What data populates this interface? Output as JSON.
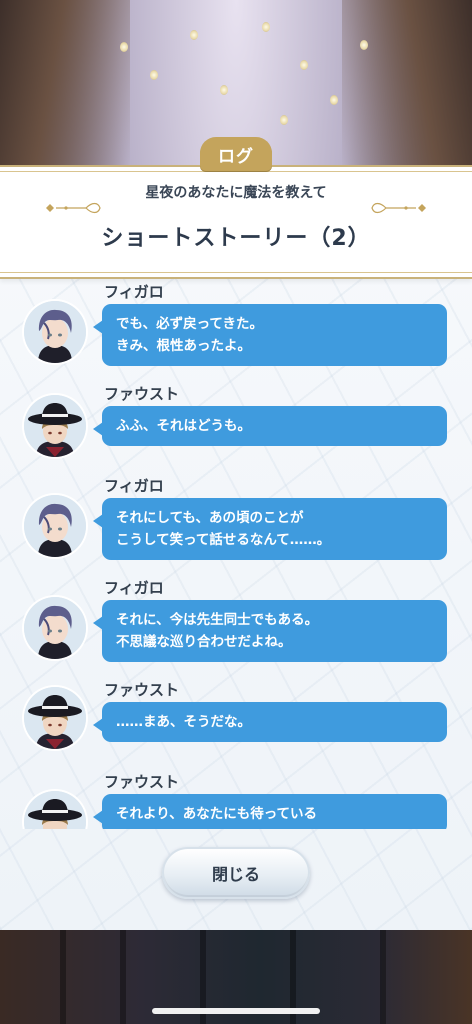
{
  "header": {
    "tab_label": "ログ",
    "subtitle": "星夜のあなたに魔法を教えて",
    "title": "ショートストーリー（2）"
  },
  "log": [
    {
      "speaker": "フィガロ",
      "avatar": "figaro",
      "lines": [
        "でも、必ず戻ってきた。",
        "きみ、根性あったよ。"
      ]
    },
    {
      "speaker": "ファウスト",
      "avatar": "faust",
      "lines": [
        "ふふ、それはどうも。"
      ]
    },
    {
      "speaker": "フィガロ",
      "avatar": "figaro",
      "lines": [
        "それにしても、あの頃のことが",
        "こうして笑って話せるなんて……。"
      ]
    },
    {
      "speaker": "フィガロ",
      "avatar": "figaro",
      "lines": [
        "それに、今は先生同士でもある。",
        "不思議な巡り合わせだよね。"
      ]
    },
    {
      "speaker": "ファウスト",
      "avatar": "faust",
      "lines": [
        "……まあ、そうだな。"
      ]
    },
    {
      "speaker": "ファウスト",
      "avatar": "faust",
      "lines": [
        "それより、あなたにも待っている"
      ]
    }
  ],
  "close_button": "閉じる",
  "colors": {
    "accent_gold": "#c4a45c",
    "bubble_blue": "#3f9bde"
  }
}
